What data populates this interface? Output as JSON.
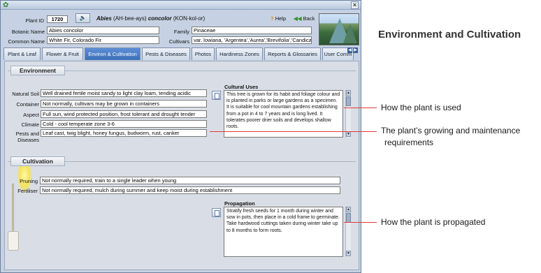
{
  "header": {
    "plant_id_label": "Plant ID",
    "plant_id": "1720",
    "species": {
      "genus": "Abies",
      "genus_pron": "(AH-bee-ays)",
      "epithet": "concolor",
      "epithet_pron": "(KON-kol-or)"
    },
    "botanic_name_label": "Botanic Name",
    "botanic_name": "Abies concolor",
    "common_name_label": "Common Name",
    "common_name": "White Fir, Colorado Fir",
    "family_label": "Family",
    "family": "Pinaceae",
    "cultivars_label": "Cultivars",
    "cultivars": "var. lowiana, 'Argentea','Aurea','Brevifolia','Candican",
    "help_label": "Help",
    "back_label": "Back"
  },
  "tabs": [
    {
      "label": "Plant & Leaf"
    },
    {
      "label": "Flower & Fruit"
    },
    {
      "label": "Environ & Cultivation",
      "active": true
    },
    {
      "label": "Pests & Diseases"
    },
    {
      "label": "Photos"
    },
    {
      "label": "Hardiness Zones"
    },
    {
      "label": "Reports & Glossaries"
    },
    {
      "label": "User Comm"
    }
  ],
  "environment": {
    "heading": "Environment",
    "rows": [
      {
        "label": "Natural Soil",
        "value": "Well drained fertile moist sandy to light clay loam, tending acidic"
      },
      {
        "label": "Container",
        "value": "Not normally, cultivars may be grown in containers"
      },
      {
        "label": "Aspect",
        "value": "Full sun, wind protected position, frost tolerant and drought tender"
      },
      {
        "label": "Climate",
        "value": "Cold - cool temperate zone 3-6"
      },
      {
        "label": "Pests and",
        "label2": "Diseases",
        "value": "Leaf cast, twig blight, honey fungus, budworm, rust, canker"
      }
    ],
    "cultural_uses_label": "Cultural Uses",
    "cultural_uses": "This tree is grown for its habit and foliage colour and is planted in parks or large gardens as a specimen. It is suitable for cool mountain gardens establishing from a pot in 4 to 7 years and is long lived. It tolerates poorer drier soils and develops shallow roots."
  },
  "cultivation": {
    "heading": "Cultivation",
    "pruning_label": "Pruning",
    "pruning": "Not normally required, train to a single leader when young",
    "fertiliser_label": "Fertiliser",
    "fertiliser": "Not normally required, mulch during summer and keep moist during establishment",
    "propagation_label": "Propagation",
    "propagation_l1": "Stratify fresh seeds for 1 month during winter and sow in pots, then place in a cold frame to germinate.",
    "propagation_l2": "Take hardwood cuttings taken during winter take up to 8 months to form roots."
  },
  "annotations": {
    "title": "Environment and Cultivation",
    "used": "How the plant is used",
    "growing_l1": "The plant’s growing and maintenance",
    "growing_l2": "requirements",
    "propagated": "How the plant is propagated"
  }
}
